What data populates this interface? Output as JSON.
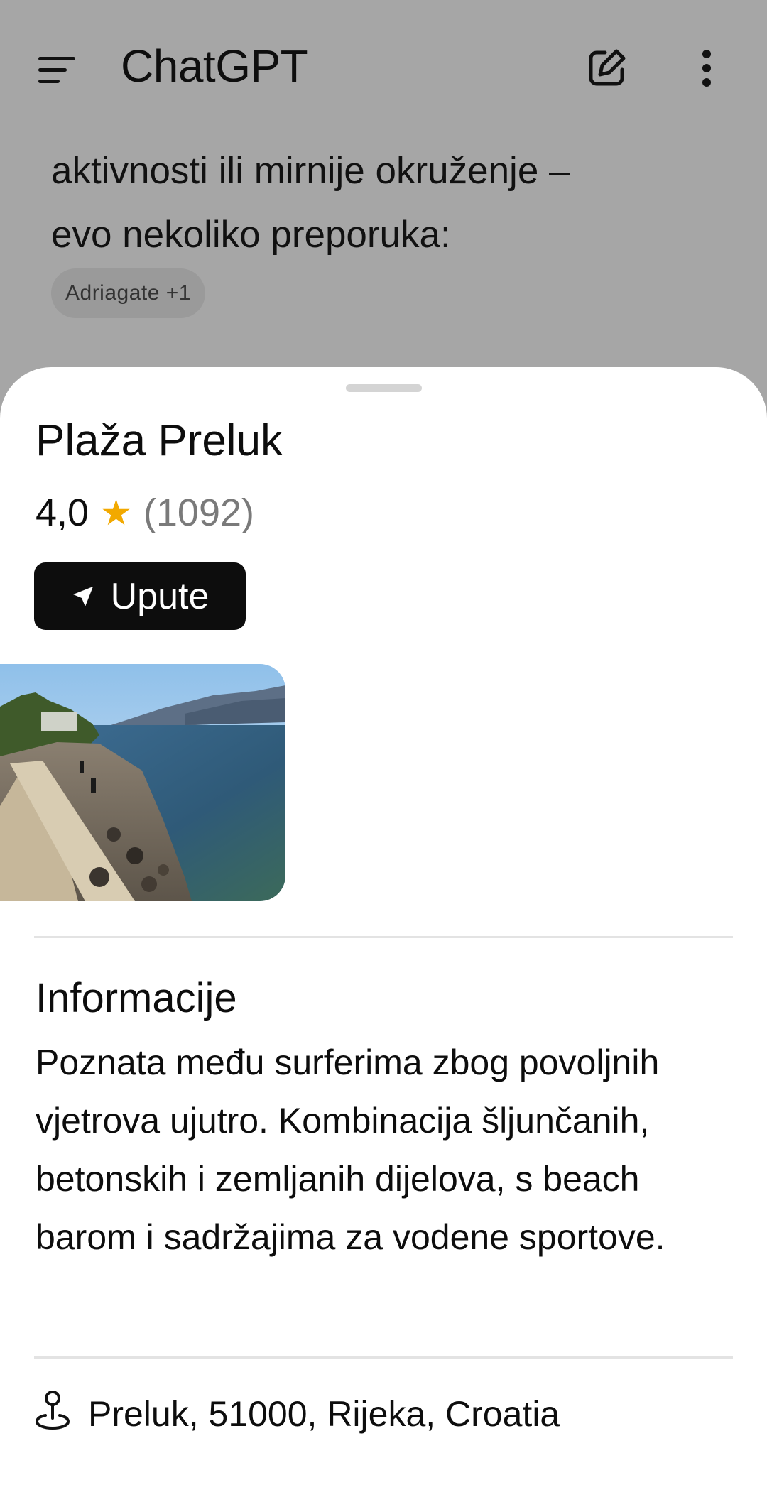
{
  "appbar": {
    "title": "ChatGPT",
    "menu_icon": "menu-icon",
    "new_chat_icon": "new-chat-icon",
    "more_icon": "more-vertical-icon"
  },
  "chat": {
    "text_line_1": "aktivnosti ili mirnije okruženje –",
    "text_line_2": "evo nekoliko preporuka:",
    "source_chip": "Adriagate +1"
  },
  "place": {
    "name": "Plaža Preluk",
    "rating": "4,0",
    "star": "★",
    "review_count": "(1092)",
    "directions_label": "Upute",
    "directions_icon": "navigation-arrow-icon",
    "photo": "beach-photo"
  },
  "info": {
    "heading": "Informacije",
    "description": "Poznata među surferima zbog povoljnih vjetrova ujutro. Kombinacija šljunčanih, betonskih i zemljanih dijelova, s beach barom i sadržajima za vodene sportove."
  },
  "address": {
    "icon": "location-pin-icon",
    "text": "Preluk, 51000, Rijeka, Croatia"
  },
  "colors": {
    "scrim": "#a6a6a6",
    "sheet": "#ffffff",
    "star": "#f2a900",
    "button": "#0d0d0d"
  }
}
